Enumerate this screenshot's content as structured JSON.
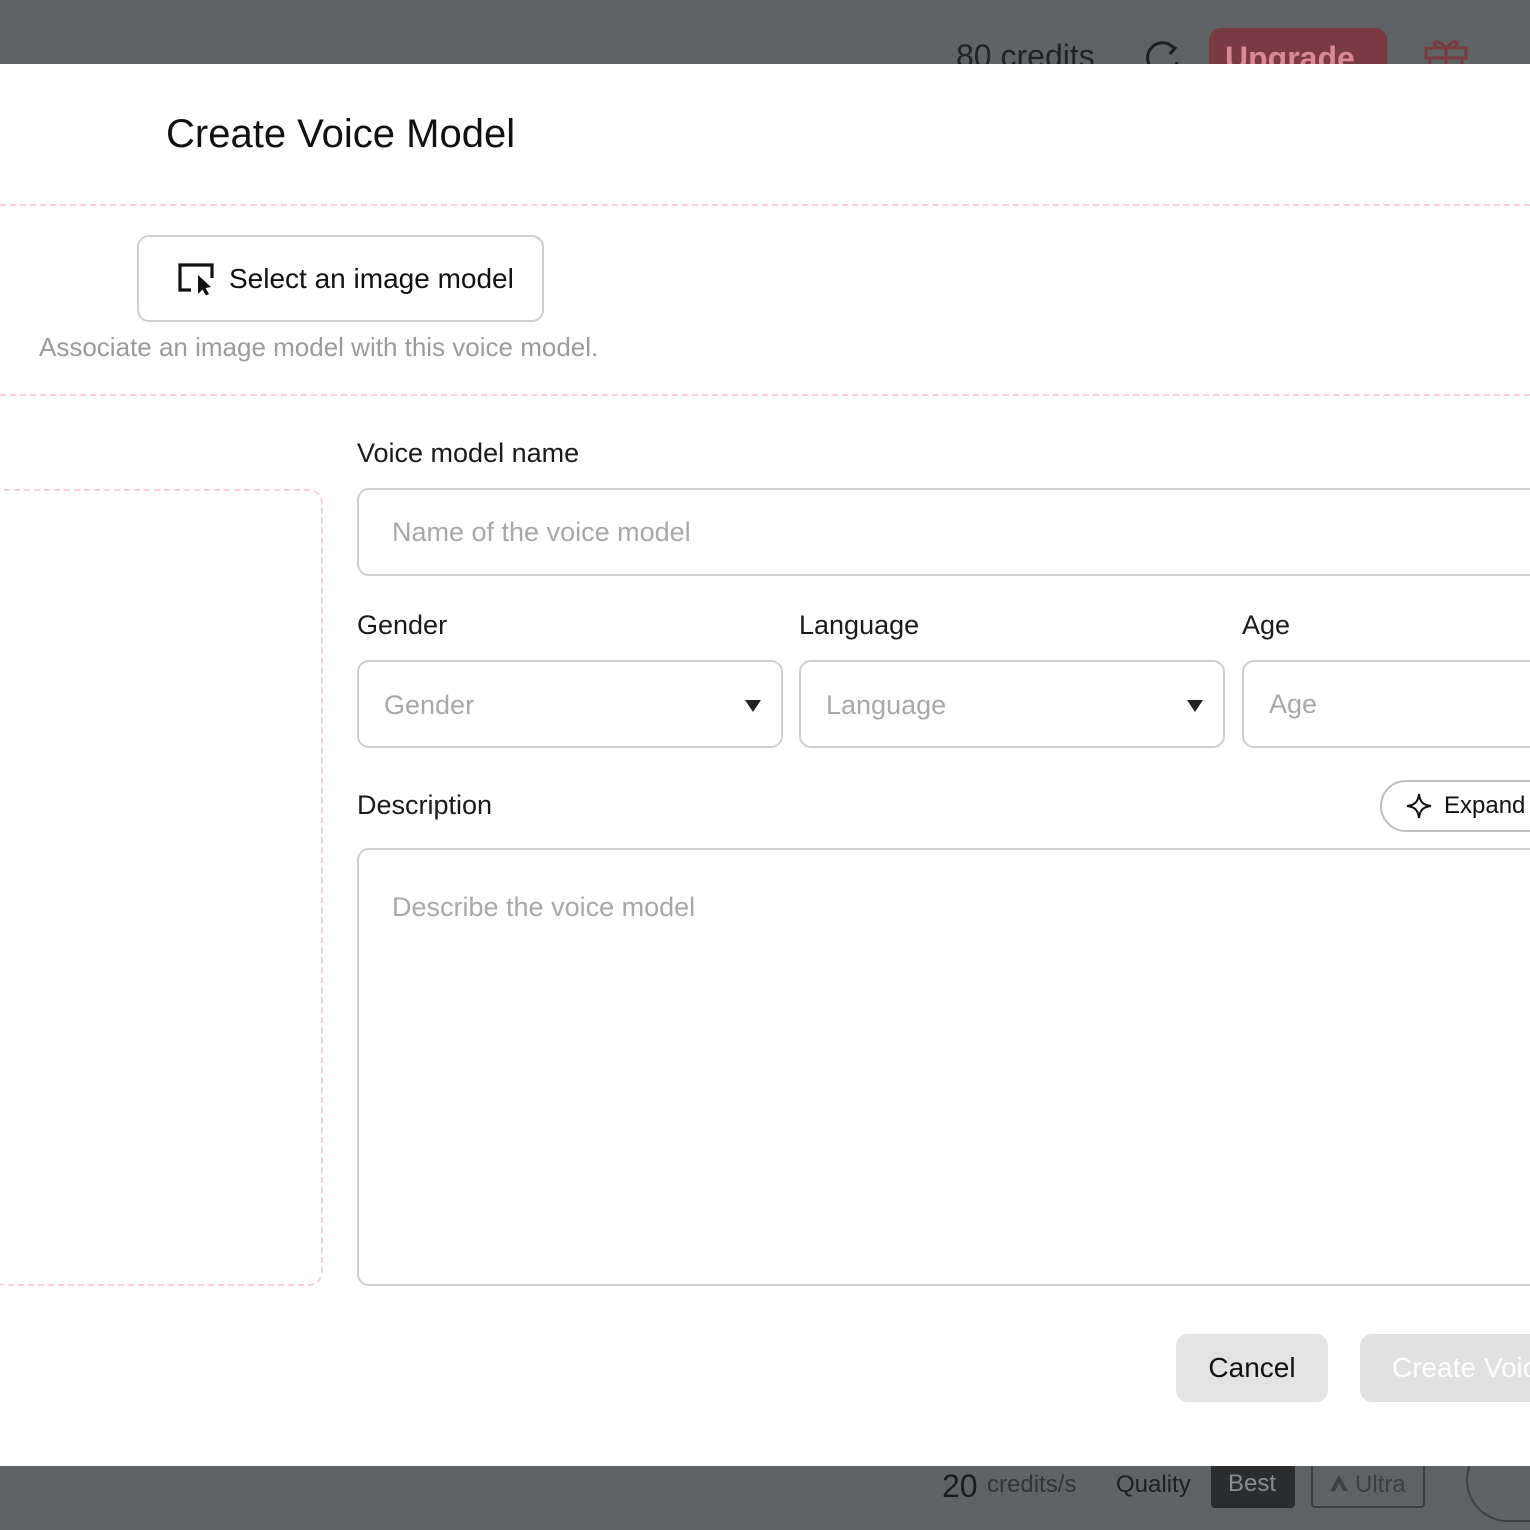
{
  "background": {
    "header": {
      "credits_text": "80 credits",
      "upgrade_label": "Upgrade"
    },
    "footer": {
      "rate_value": "20",
      "rate_unit": "credits/s",
      "quality_label": "Quality",
      "quality_best": "Best",
      "quality_ultra": "Ultra"
    }
  },
  "modal": {
    "title": "Create Voice Model",
    "select_image_label": "Select an image model",
    "select_image_hint": "Associate an image model with this voice model.",
    "name": {
      "label": "Voice model name",
      "placeholder": "Name of the voice model",
      "value": ""
    },
    "gender": {
      "label": "Gender",
      "placeholder": "Gender"
    },
    "language": {
      "label": "Language",
      "placeholder": "Language"
    },
    "age": {
      "label": "Age",
      "placeholder": "Age",
      "value": ""
    },
    "description": {
      "label": "Description",
      "placeholder": "Describe the voice model",
      "value": "",
      "expand_label": "Expand"
    },
    "cancel_label": "Cancel",
    "create_label": "Create Voice Model"
  },
  "icons": {
    "select_image": "cursor-select-icon",
    "refresh": "refresh-icon",
    "gift": "gift-icon",
    "expand": "sparkle-icon",
    "ultra": "ultra-icon",
    "caret": "chevron-down-icon"
  },
  "colors": {
    "backdrop": "#616466",
    "modal_bg": "#ffffff",
    "divider_dash": "#f6d3dc",
    "input_border": "#cfcfcf",
    "placeholder": "#a8a8a8",
    "cancel_bg": "#e3e3e3",
    "create_disabled_bg": "#e1e1e1",
    "upgrade_bg": "#7a3a44"
  }
}
